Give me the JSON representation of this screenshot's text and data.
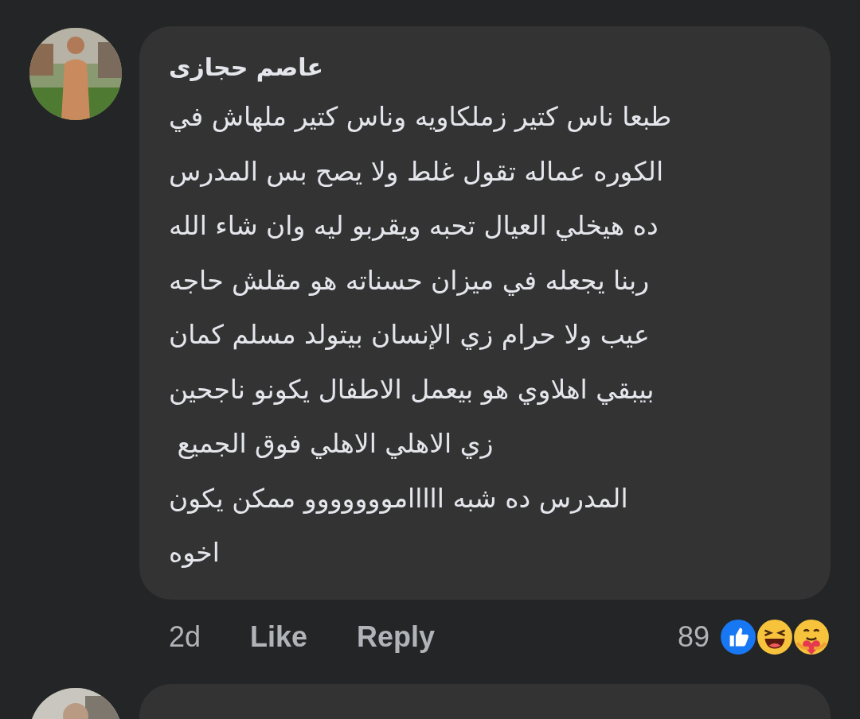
{
  "comments": [
    {
      "author": "عاصم حجازى",
      "text_lines": [
        "طبعا ناس كتير زملكاويه وناس كتير ملهاش في",
        "الكوره عماله تقول غلط ولا يصح بس المدرس",
        "ده هيخلي العيال تحبه ويقربو ليه وان شاء الله",
        "ربنا يجعله في ميزان حسناته هو مقلش حاجه",
        "عيب ولا حرام زي الإنسان بيتولد مسلم كمان",
        "بيبقي اهلاوي هو بيعمل الاطفال يكونو ناجحين",
        "زي الاهلي الاهلي فوق الجميع ",
        "المدرس ده شبه ااااامووووووو ممكن يكون",
        "اخوه"
      ],
      "time": "2d",
      "like": "Like",
      "reply": "Reply",
      "reaction_count": "89"
    },
    {
      "kind": "partial"
    }
  ]
}
